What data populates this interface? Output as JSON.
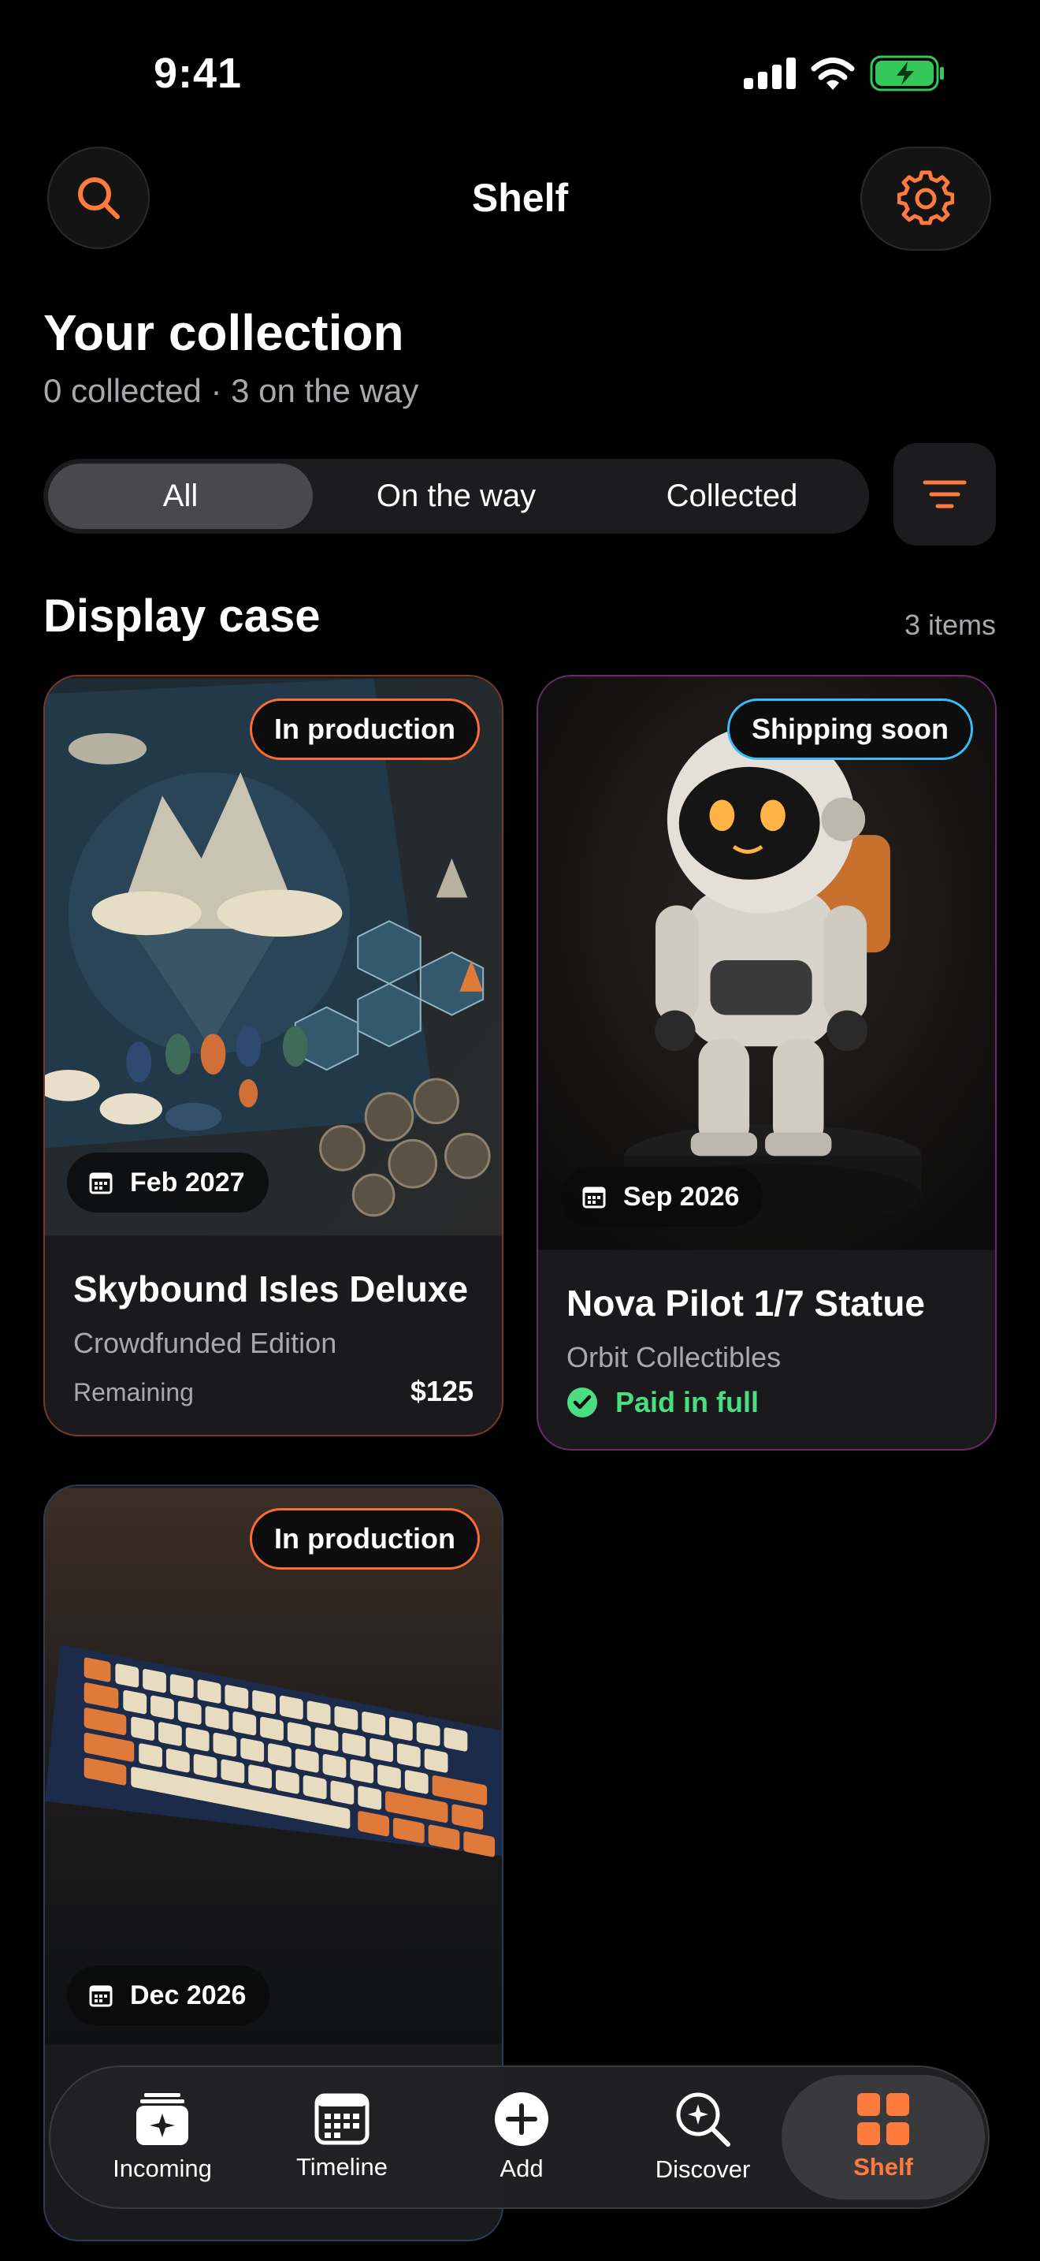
{
  "status": {
    "time": "9:41"
  },
  "header": {
    "title": "Shelf",
    "search_icon": "search-icon",
    "settings_icon": "gear-icon"
  },
  "collection": {
    "title": "Your collection",
    "summary": "0 collected · 3 on the way"
  },
  "filters": {
    "tabs": [
      "All",
      "On the way",
      "Collected"
    ],
    "active": "All",
    "sort_icon": "filter-lines-icon"
  },
  "display_case": {
    "title": "Display case",
    "count": "3 items"
  },
  "cards": [
    {
      "status": "In production",
      "status_color": "#ff6b35",
      "date": "Feb 2027",
      "name": "Skybound Isles Deluxe",
      "maker": "Crowdfunded Edition",
      "remaining_label": "Remaining",
      "price": "$125"
    },
    {
      "status": "Shipping soon",
      "status_color": "#38bdf8",
      "date": "Sep 2026",
      "name": "Nova Pilot 1/7 Statue",
      "maker": "Orbit Collectibles",
      "paid_label": "Paid in full",
      "paid_color": "#4ade80"
    },
    {
      "status": "In production",
      "status_color": "#ff6b35",
      "date": "Dec 2026"
    }
  ],
  "tabbar": {
    "items": [
      {
        "label": "Incoming",
        "icon": "incoming-tray-icon"
      },
      {
        "label": "Timeline",
        "icon": "calendar-icon"
      },
      {
        "label": "Add",
        "icon": "plus-circle-icon"
      },
      {
        "label": "Discover",
        "icon": "discover-search-icon"
      },
      {
        "label": "Shelf",
        "icon": "grid-icon"
      }
    ],
    "active": "Shelf"
  },
  "colors": {
    "accent": "#ff7a3d",
    "background": "#000000",
    "card": "#1a1a1c"
  }
}
